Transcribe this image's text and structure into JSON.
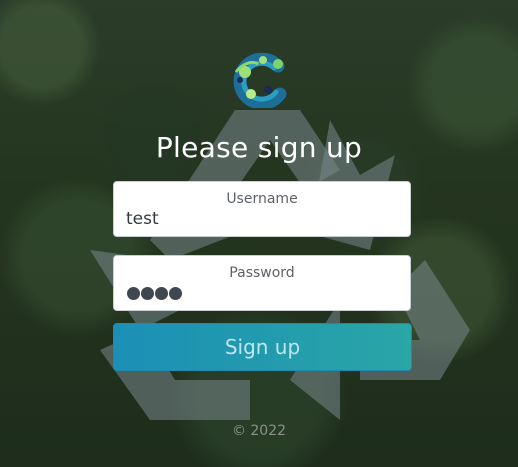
{
  "page": {
    "heading": "Please sign up",
    "footer": "© 2022"
  },
  "form": {
    "username": {
      "label": "Username",
      "value": "test"
    },
    "password": {
      "label": "Password",
      "masked_length": 4
    },
    "submit_label": "Sign up"
  },
  "colors": {
    "button_start": "#1b8fb6",
    "button_end": "#2aa6a6",
    "button_text": "#bfe6ec",
    "heading_text": "#ffffff"
  },
  "icons": {
    "logo": "brand-logo-icon",
    "background": "recycle-symbol-background"
  }
}
